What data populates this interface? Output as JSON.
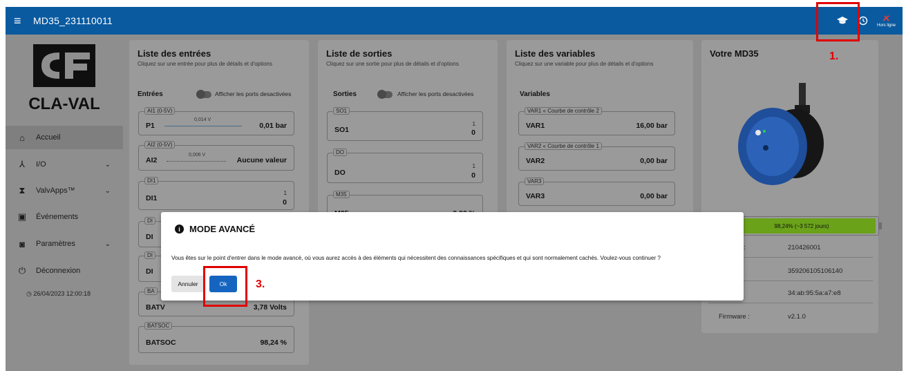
{
  "topbar": {
    "menu_icon": "hamburger-icon",
    "title": "MD35_231110011",
    "offline_label": "Hors ligne"
  },
  "sidebar": {
    "logo_text": "CLA-VAL",
    "items": [
      {
        "label": "Accueil",
        "icon": "home-icon"
      },
      {
        "label": "I/O",
        "icon": "io-icon"
      },
      {
        "label": "ValvApps™",
        "icon": "valve-icon"
      },
      {
        "label": "Événements",
        "icon": "calendar-icon"
      },
      {
        "label": "Paramètres",
        "icon": "settings-icon"
      },
      {
        "label": "Déconnexion",
        "icon": "power-icon"
      }
    ],
    "timestamp": "26/04/2023 12:00:18"
  },
  "inputs_card": {
    "title": "Liste des entrées",
    "subtitle": "Cliquez sur une entrée pour plus de détails et d'options",
    "section": "Entrées",
    "toggle_label": "Afficher les ports desactivées",
    "items": [
      {
        "tag": "AI1 (0-5V)",
        "name": "P1",
        "small": "0,014 V",
        "value": "0,01 bar"
      },
      {
        "tag": "AI2 (0-5V)",
        "name": "AI2",
        "small": "0,006 V",
        "value": "Aucune valeur"
      },
      {
        "tag": "DI1",
        "name": "DI1",
        "top": "1",
        "value": "0"
      },
      {
        "tag": "DI",
        "name": "DI"
      },
      {
        "tag": "DI",
        "name": "DI"
      },
      {
        "tag": "BA",
        "name": "BATV",
        "value": "3,78 Volts"
      },
      {
        "tag": "BATSOC",
        "name": "BATSOC",
        "value": "98,24 %"
      }
    ]
  },
  "outputs_card": {
    "title": "Liste de sorties",
    "subtitle": "Cliquez sur une sortie pour plus de détails et d'options",
    "section": "Sorties",
    "toggle_label": "Afficher les ports desactivées",
    "items": [
      {
        "tag": "SO1",
        "name": "SO1",
        "top": "1",
        "value": "0"
      },
      {
        "tag": "DO",
        "name": "DO",
        "top": "1",
        "value": "0"
      },
      {
        "tag": "M35",
        "name": "M35",
        "value": "0,00 %"
      }
    ]
  },
  "variables_card": {
    "title": "Liste des variables",
    "subtitle": "Cliquez sur une variable pour plus de détails et d'options",
    "section": "Variables",
    "items": [
      {
        "tag": "VAR1 « Courbe de contrôle 2",
        "name": "VAR1",
        "value": "16,00 bar"
      },
      {
        "tag": "VAR2 « Courbe de contrôle 1",
        "name": "VAR2",
        "value": "0,00 bar"
      },
      {
        "tag": "VAR3",
        "name": "VAR3",
        "value": "0,00 bar"
      }
    ]
  },
  "device_card": {
    "title": "Votre MD35",
    "battery_text": "98,24% (~3 572 jours)",
    "battery_level": 0.9824,
    "battery_color": "#6aa21a",
    "rows": [
      {
        "key": "de série :",
        "value": "210426001"
      },
      {
        "key": "",
        "value": "359206105106140"
      },
      {
        "key": "",
        "value": "34:ab:95:5a:a7:e8"
      },
      {
        "key": "Firmware :",
        "value": "v2.1.0"
      }
    ]
  },
  "modal": {
    "title": "MODE AVANCÉ",
    "body": "Vous êtes sur le point d'entrer dans le mode avancé, où vous aurez accès à des éléments qui nécessitent des connaissances spécifiques et qui sont normalement cachés. Voulez-vous continuer ?",
    "cancel_label": "Annuler",
    "ok_label": "Ok"
  },
  "annotations": {
    "step1": "1.",
    "step3": "3.",
    "highlight_color": "#e00000"
  },
  "colors": {
    "primary": "#0a5aa0",
    "ok_button": "#1565c0"
  }
}
